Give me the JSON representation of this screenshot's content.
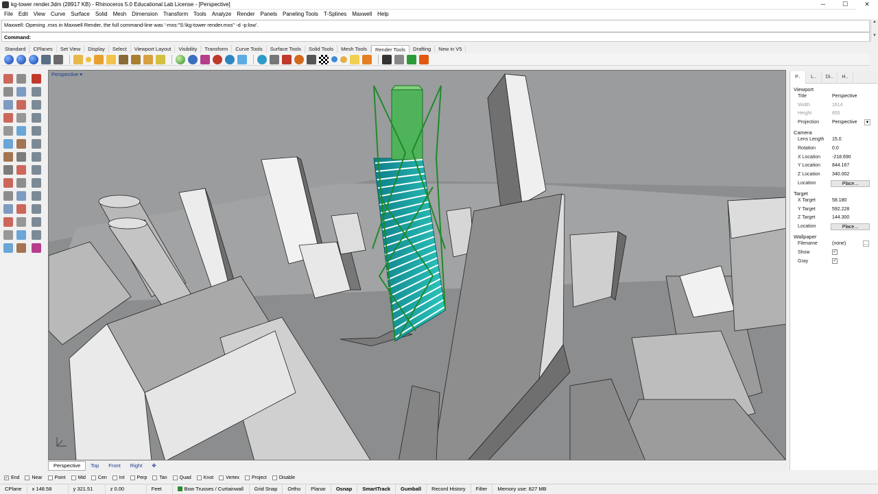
{
  "window": {
    "title": "kg-tower render.3dm (28917 KB) - Rhinoceros 5.0 Educational Lab License - [Perspective]",
    "min": "─",
    "max": "☐",
    "close": "✕"
  },
  "menu": [
    "File",
    "Edit",
    "View",
    "Curve",
    "Surface",
    "Solid",
    "Mesh",
    "Dimension",
    "Transform",
    "Tools",
    "Analyze",
    "Render",
    "Panels",
    "Paneling Tools",
    "T-Splines",
    "Maxwell",
    "Help"
  ],
  "command": {
    "history": "Maxwell: Opening .mxs in Maxwell Render, the full command-line was '-mxs:\"S:\\kg-tower render.mxs\" -d -p:low'.",
    "label": "Command:",
    "value": ""
  },
  "toolbar_tabs": [
    "Standard",
    "CPlanes",
    "Set View",
    "Display",
    "Select",
    "Viewport Layout",
    "Visibility",
    "Transform",
    "Curve Tools",
    "Surface Tools",
    "Solid Tools",
    "Mesh Tools",
    "Render Tools",
    "Drafting",
    "New in V5"
  ],
  "active_toolbar_tab": "Render Tools",
  "viewport": {
    "label": "Perspective",
    "dropdown": "▾"
  },
  "viewport_tabs": [
    "Perspective",
    "Top",
    "Front",
    "Right"
  ],
  "viewport_tab_add": "✥",
  "panel": {
    "tabs": [
      "P..",
      "L..",
      "Di..",
      "H.."
    ],
    "viewport_section": "Viewport",
    "rows_viewport": [
      {
        "k": "Title",
        "v": "Perspective",
        "dim": false
      },
      {
        "k": "Width",
        "v": "1614",
        "dim": true
      },
      {
        "k": "Height",
        "v": "855",
        "dim": true
      },
      {
        "k": "Projection",
        "v": "Perspective",
        "dim": false
      }
    ],
    "camera_section": "Camera",
    "rows_camera": [
      {
        "k": "Lens Length",
        "v": "15.0"
      },
      {
        "k": "Rotation",
        "v": "0.0"
      },
      {
        "k": "X Location",
        "v": "-218.690"
      },
      {
        "k": "Y Location",
        "v": "844.167"
      },
      {
        "k": "Z Location",
        "v": "340.002"
      }
    ],
    "location_label": "Location",
    "place_button": "Place...",
    "target_section": "Target",
    "rows_target": [
      {
        "k": "X Target",
        "v": "58.180"
      },
      {
        "k": "Y Target",
        "v": "592.228"
      },
      {
        "k": "Z Target",
        "v": "144.300"
      }
    ],
    "wallpaper_section": "Wallpaper",
    "filename_label": "Filename",
    "filename_value": "(none)",
    "show_label": "Show",
    "gray_label": "Gray",
    "check": "✓"
  },
  "osnaps": [
    {
      "label": "End",
      "checked": true
    },
    {
      "label": "Near",
      "checked": false
    },
    {
      "label": "Point",
      "checked": false
    },
    {
      "label": "Mid",
      "checked": false
    },
    {
      "label": "Cen",
      "checked": false
    },
    {
      "label": "Int",
      "checked": false
    },
    {
      "label": "Perp",
      "checked": false
    },
    {
      "label": "Tan",
      "checked": false
    },
    {
      "label": "Quad",
      "checked": false
    },
    {
      "label": "Knot",
      "checked": false
    },
    {
      "label": "Vertex",
      "checked": false
    },
    {
      "label": "Project",
      "checked": false
    },
    {
      "label": "Disable",
      "checked": false
    }
  ],
  "status": {
    "cplane": "CPlane",
    "x": "x 148.58",
    "y": "y 321.51",
    "z": "z 0.00",
    "units": "Feet",
    "layer": "Bow Trusses / Curtainwall",
    "layer_color": "#2e8b2e",
    "grid_snap": "Grid Snap",
    "ortho": "Ortho",
    "planar": "Planar",
    "osnap": "Osnap",
    "smarttrack": "SmartTrack",
    "gumball": "Gumball",
    "record_history": "Record History",
    "filter": "Filter",
    "memory": "Memory use: 827 MB"
  },
  "colors": {
    "accent_green": "#2e9a3a",
    "glass_teal": "#1fa6a0",
    "viewport_bg": "#9a9c9d"
  }
}
